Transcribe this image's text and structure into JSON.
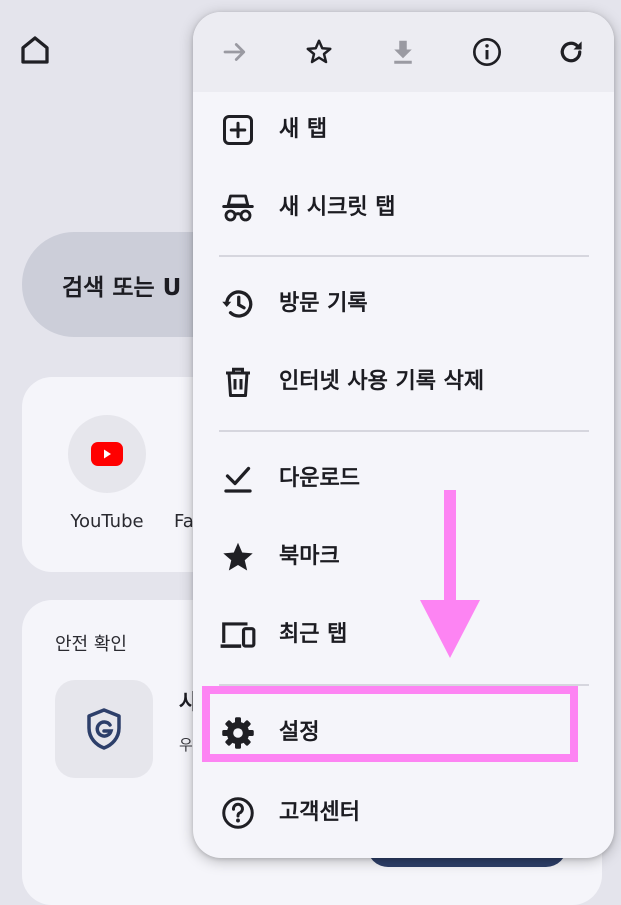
{
  "background": {
    "search_text": "검색 또는 U",
    "shortcuts": [
      {
        "label": "YouTube"
      },
      {
        "label": "Fa"
      }
    ],
    "safety_check": {
      "title": "안전 확인",
      "heading": "사",
      "subtitle": "우"
    }
  },
  "menu": {
    "toolbar": [
      {
        "icon": "forward-arrow-icon",
        "enabled": false
      },
      {
        "icon": "star-outline-icon",
        "enabled": true
      },
      {
        "icon": "download-icon",
        "enabled": false
      },
      {
        "icon": "info-icon",
        "enabled": true
      },
      {
        "icon": "refresh-icon",
        "enabled": true
      }
    ],
    "items": [
      {
        "label": "새 탭",
        "icon": "new-tab-icon"
      },
      {
        "label": "새 시크릿 탭",
        "icon": "incognito-icon"
      },
      {
        "label": "방문 기록",
        "icon": "history-icon"
      },
      {
        "label": "인터넷 사용 기록 삭제",
        "icon": "trash-icon"
      },
      {
        "label": "다운로드",
        "icon": "download-check-icon"
      },
      {
        "label": "북마크",
        "icon": "star-filled-icon"
      },
      {
        "label": "최근 탭",
        "icon": "devices-icon"
      },
      {
        "label": "설정",
        "icon": "gear-icon"
      },
      {
        "label": "고객센터",
        "icon": "help-icon"
      }
    ]
  },
  "annotation": {
    "color": "#fd84f3",
    "target": "설정"
  },
  "colors": {
    "page_bg": "#e4e4ec",
    "menu_bg": "#f5f5fa",
    "toolbar_bg": "#ececf2",
    "icon": "#1f1f24",
    "disabled_icon": "#9a9aa2"
  }
}
